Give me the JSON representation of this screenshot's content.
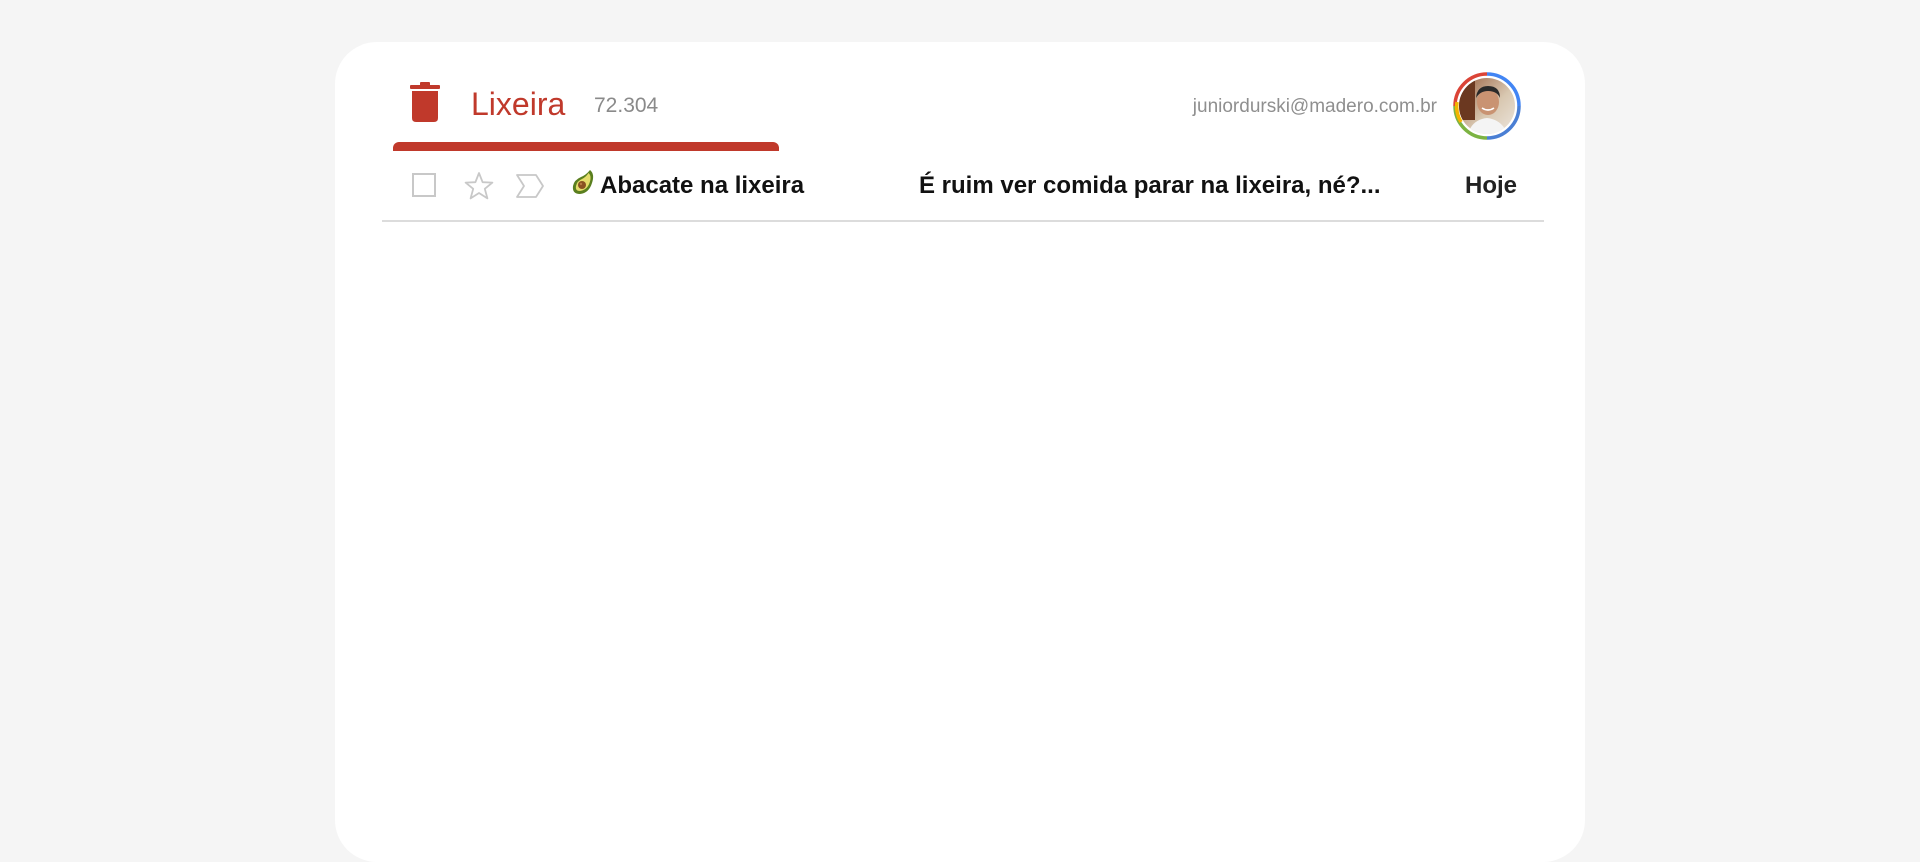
{
  "folder": {
    "title": "Lixeira",
    "count": "72.304",
    "icon": "trash-icon",
    "accent_color": "#c0392b"
  },
  "account": {
    "email": "juniordurski@madero.com.br",
    "avatar_ring_colors": [
      "#db4437",
      "#f4b400",
      "#0f9d58",
      "#4285f4"
    ]
  },
  "messages": [
    {
      "icon": "avocado-icon",
      "sender": "Abacate na lixeira",
      "subject": "É ruim ver comida parar na lixeira, né?...",
      "date": "Hoje"
    }
  ]
}
